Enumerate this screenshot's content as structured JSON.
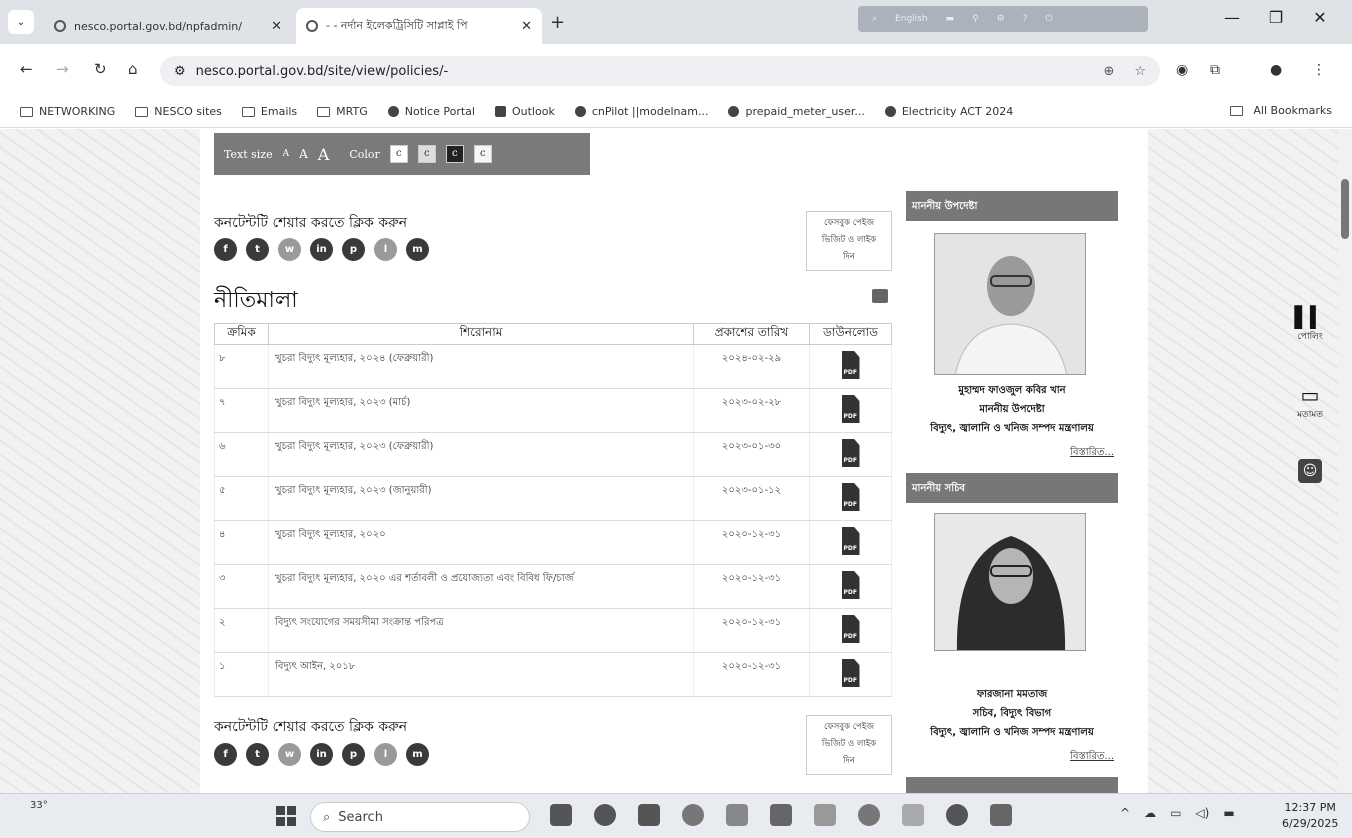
{
  "browser": {
    "tabs": [
      {
        "title": "nesco.portal.gov.bd/npfadmin/",
        "active": false
      },
      {
        "title": "- - নর্দান ইলেকট্রিসিটি সাপ্লাই পি",
        "active": true
      }
    ],
    "url": "nesco.portal.gov.bd/site/view/policies/-",
    "bookmarks": [
      {
        "label": "NETWORKING",
        "icon": "folder-icon"
      },
      {
        "label": "NESCO sites",
        "icon": "folder-icon"
      },
      {
        "label": "Emails",
        "icon": "folder-icon"
      },
      {
        "label": "MRTG",
        "icon": "folder-icon"
      },
      {
        "label": "Notice Portal",
        "icon": "globe-icon"
      },
      {
        "label": "Outlook",
        "icon": "outlook-icon"
      },
      {
        "label": "cnPilot ||modelnam...",
        "icon": "globe-icon"
      },
      {
        "label": "prepaid_meter_user...",
        "icon": "globe-icon"
      },
      {
        "label": "Electricity ACT 2024",
        "icon": "globe-icon"
      }
    ],
    "all_bookmarks": "All Bookmarks",
    "ext_lang": "English"
  },
  "toolbar": {
    "text_size_label": "Text size",
    "sizes": [
      "A",
      "A",
      "A"
    ],
    "color_label": "Color",
    "color_options": [
      "c",
      "c",
      "c",
      "c"
    ]
  },
  "share": {
    "title": "কনটেন্টটি শেয়ার করতে ক্লিক করুন",
    "fb_box_line1": "ফেসবুক পেইজ",
    "fb_box_line2": "ভিজিট ও লাইক",
    "fb_box_line3": "দিন",
    "icons": [
      "f",
      "t",
      "w",
      "in",
      "p",
      "l",
      "m"
    ]
  },
  "page": {
    "title": "নীতিমালা",
    "columns": [
      "ক্রমিক",
      "শিরোনাম",
      "প্রকাশের তারিখ",
      "ডাউনলোড"
    ],
    "rows": [
      {
        "sl": "৮",
        "title": "খুচরা বিদ্যুৎ মূল্যহার, ২০২৪ (ফেব্রুয়ারী)",
        "date": "২০২৪-০২-২৯"
      },
      {
        "sl": "৭",
        "title": "খুচরা বিদ্যুৎ মূল্যহার, ২০২৩ (মার্চ)",
        "date": "২০২৩-০২-২৮"
      },
      {
        "sl": "৬",
        "title": "খুচরা বিদ্যুৎ মূল্যহার, ২০২৩ (ফেব্রুয়ারী)",
        "date": "২০২৩-০১-৩০"
      },
      {
        "sl": "৫",
        "title": "খুচরা বিদ্যুৎ মূল্যহার, ২০২৩ (জানুয়ারী)",
        "date": "২০২৩-০১-১২"
      },
      {
        "sl": "৪",
        "title": "খুচরা বিদ্যুৎ মূল্যহার, ২০২০",
        "date": "২০২০-১২-৩১"
      },
      {
        "sl": "৩",
        "title": "খুচরা বিদ্যুৎ মূল্যহার, ২০২০ এর শর্তাবলী ও প্রযোজ্যতা এবং বিবিধ ফি/চার্জ",
        "date": "২০২০-১২-৩১"
      },
      {
        "sl": "২",
        "title": "বিদ্যুৎ সংযোগের সময়সীমা সংক্রান্ত পরিপত্র",
        "date": "২০২০-১২-৩১"
      },
      {
        "sl": "১",
        "title": "বিদ্যুৎ আইন, ২০১৮",
        "date": "২০২০-১২-৩১"
      }
    ],
    "pdf_label": "PDF"
  },
  "sidebar": {
    "advisor_head": "মাননীয় উপদেষ্টা",
    "advisor_name": "মুহাম্মদ ফাওজুল কবির খান",
    "advisor_role": "মাননীয় উপদেষ্টা",
    "advisor_ministry": "বিদ্যুৎ, জ্বালানি ও খনিজ সম্পদ মন্ত্রণালয়",
    "secretary_head": "মাননীয় সচিব",
    "secretary_name": "ফারজানা মমতাজ",
    "secretary_role": "সচিব, বিদ্যুৎ বিভাগ",
    "secretary_ministry": "বিদ্যুৎ, জ্বালানি ও খনিজ সম্পদ মন্ত্রণালয়",
    "more": "বিস্তারিত..."
  },
  "widgets": {
    "poll": "পোলিং",
    "feedback": "মতামত"
  },
  "taskbar": {
    "search_placeholder": "Search",
    "time": "12:37 PM",
    "date": "6/29/2025",
    "weather": "33°"
  }
}
